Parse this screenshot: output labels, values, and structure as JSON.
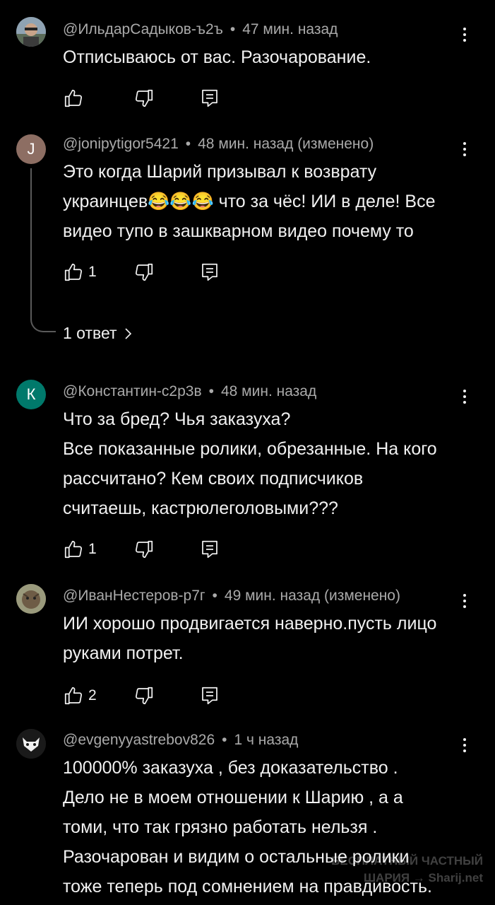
{
  "icons": {
    "like": "thumb-up-icon",
    "dislike": "thumb-down-icon",
    "reply": "reply-icon",
    "more": "more-vert-icon",
    "chevron": "chevron-right-icon"
  },
  "comments": [
    {
      "author": "@ИльдарСадыков-ъ2ъ",
      "time": "47 мин. назад",
      "body": [
        "Отписываюсь от вас. Разочарование."
      ],
      "likes": ""
    },
    {
      "author": "@jonipytigor5421",
      "avatar_letter": "J",
      "avatar_color": "#8d6e63",
      "time": "48 мин. назад (изменено)",
      "body": [
        "Это когда Шарий призывал к возврату",
        "украинцев😂😂😂 что за чёс! ИИ в деле! Все",
        "видео тупо в зашкварном видео почему то"
      ],
      "likes": "1",
      "replies": "1 ответ"
    },
    {
      "author": "@Константин-с2р3в",
      "avatar_letter": "К",
      "avatar_color": "#00796b",
      "time": "48 мин. назад",
      "body": [
        "Что за бред? Чья заказуха?",
        "Все показанные ролики, обрезанные. На кого",
        "рассчитано? Кем своих подписчиков",
        "считаешь, кастрюлеголовыми???"
      ],
      "likes": "1"
    },
    {
      "author": "@ИванНестеров-р7г",
      "time": "49 мин. назад (изменено)",
      "body": [
        "ИИ хорошо продвигается наверно.пусть лицо",
        "руками потрет."
      ],
      "likes": "2"
    },
    {
      "author": "@evgenyyastrebov826",
      "time": "1 ч назад",
      "body": [
        "100000% заказуха , без доказательство .",
        "Дело не в моем отношении к  Шарию , а а",
        "томи, что так грязно работать нельзя .",
        "Разочарован и видим о остальные ролики",
        "тоже теперь под сомнением на правдивость."
      ]
    }
  ],
  "watermark": [
    "БЕСПЛАТНЫЙ ЧАСТНЫЙ",
    "ШАРИЯ → Sharij.net"
  ]
}
